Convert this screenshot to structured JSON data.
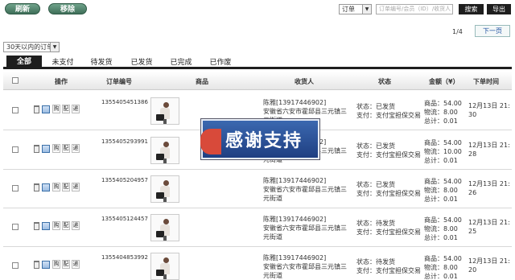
{
  "toolbar": {
    "refresh_label": "刷新",
    "remove_label": "移除",
    "type_select": "订单",
    "search_placeholder": "订单编号/会员（ID）/收货人",
    "search_label": "搜索",
    "export_label": "导出"
  },
  "pagination": {
    "info": "1/4",
    "next_label": "下一页"
  },
  "filter": {
    "range": "30天以内的订单"
  },
  "tabs": [
    "全部",
    "未支付",
    "待发货",
    "已发货",
    "已完成",
    "已作废"
  ],
  "table": {
    "headers": {
      "action": "操作",
      "order_no": "订单编号",
      "product": "商品",
      "buyer": "收货人",
      "status": "状态",
      "amount": "金额（¥）",
      "time": "下单时间"
    },
    "actions": {
      "buy": "购",
      "match": "配",
      "ship": "递"
    },
    "rows": [
      {
        "order_no": "1355405451386",
        "buyer_name": "陈雅[13917446902]",
        "buyer_addr": "安徽省六安市霍邱县三元镇三元街道",
        "status_line": "状态：已发货",
        "pay_line": "支付：支付宝担保交易",
        "goods_line": "商品：54.00",
        "ship_line": "物流：8.00",
        "total_line": "总计：0.01",
        "time": "12月13日 21:30"
      },
      {
        "order_no": "1355405293991",
        "buyer_name": "陈雅[13917446902]",
        "buyer_addr": "安徽省六安市霍邱县三元镇三元街道",
        "status_line": "状态：已发货",
        "pay_line": "支付：支付宝担保交易",
        "goods_line": "商品：54.00",
        "ship_line": "物流：10.00",
        "total_line": "总计：0.01",
        "time": "12月13日 21:28"
      },
      {
        "order_no": "1355405204957",
        "buyer_name": "陈雅[13917446902]",
        "buyer_addr": "安徽省六安市霍邱县三元镇三元街道",
        "status_line": "状态：已发货",
        "pay_line": "支付：支付宝担保交易",
        "goods_line": "商品：54.00",
        "ship_line": "物流：8.00",
        "total_line": "总计：0.01",
        "time": "12月13日 21:26"
      },
      {
        "order_no": "1355405124457",
        "buyer_name": "陈雅[13917446902]",
        "buyer_addr": "安徽省六安市霍邱县三元镇三元街道",
        "status_line": "状态：待发货",
        "pay_line": "支付：支付宝担保交易",
        "goods_line": "商品：54.00",
        "ship_line": "物流：8.00",
        "total_line": "总计：0.01",
        "time": "12月13日 21:25"
      },
      {
        "order_no": "1355404853992",
        "buyer_name": "陈雅[13917446902]",
        "buyer_addr": "安徽省六安市霍邱县三元镇三元街道",
        "status_line": "状态：待发货",
        "pay_line": "支付：支付宝担保交易",
        "goods_line": "商品：54.00",
        "ship_line": "物流：8.00",
        "total_line": "总计：0.01",
        "time": "12月13日 21:20"
      }
    ]
  },
  "overlay": {
    "text": "感谢支持"
  }
}
